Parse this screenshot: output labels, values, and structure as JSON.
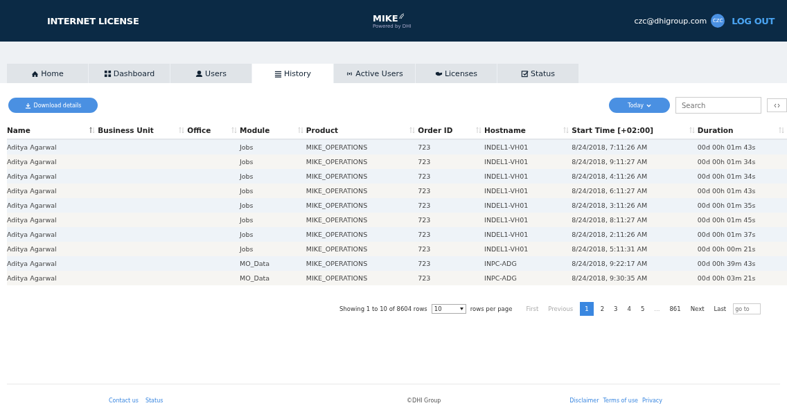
{
  "header": {
    "title": "INTERNET LICENSE",
    "logo": {
      "name": "MIKE",
      "tagline": "Powered by DHI"
    },
    "user_email": "czc@dhigroup.com",
    "avatar": "CZC",
    "logout": "LOG OUT"
  },
  "tabs": [
    {
      "label": "Home",
      "selected": false
    },
    {
      "label": "Dashboard",
      "selected": false
    },
    {
      "label": "Users",
      "selected": false
    },
    {
      "label": "History",
      "selected": true
    },
    {
      "label": "Active Users",
      "selected": false
    },
    {
      "label": "Licenses",
      "selected": false
    },
    {
      "label": "Status",
      "selected": false
    }
  ],
  "toolbar": {
    "download": "Download details",
    "period": "Today",
    "search": {
      "placeholder": "Search"
    }
  },
  "table": {
    "columns": [
      {
        "label": "Name",
        "sorted": true
      },
      {
        "label": "Business Unit",
        "sorted": false
      },
      {
        "label": "Office",
        "sorted": false
      },
      {
        "label": "Module",
        "sorted": false
      },
      {
        "label": "Product",
        "sorted": false
      },
      {
        "label": "Order ID",
        "sorted": false
      },
      {
        "label": "Hostname",
        "sorted": false
      },
      {
        "label": "Start Time [+02:00]",
        "sorted": false
      },
      {
        "label": "Duration",
        "sorted": false
      }
    ],
    "rows": [
      [
        "Aditya Agarwal",
        "",
        "",
        "Jobs",
        "MIKE_OPERATIONS",
        "723",
        "INDEL1-VH01",
        "8/24/2018, 7:11:26 AM",
        "00d 00h 01m 43s"
      ],
      [
        "Aditya Agarwal",
        "",
        "",
        "Jobs",
        "MIKE_OPERATIONS",
        "723",
        "INDEL1-VH01",
        "8/24/2018, 9:11:27 AM",
        "00d 00h 01m 34s"
      ],
      [
        "Aditya Agarwal",
        "",
        "",
        "Jobs",
        "MIKE_OPERATIONS",
        "723",
        "INDEL1-VH01",
        "8/24/2018, 4:11:26 AM",
        "00d 00h 01m 34s"
      ],
      [
        "Aditya Agarwal",
        "",
        "",
        "Jobs",
        "MIKE_OPERATIONS",
        "723",
        "INDEL1-VH01",
        "8/24/2018, 6:11:27 AM",
        "00d 00h 01m 43s"
      ],
      [
        "Aditya Agarwal",
        "",
        "",
        "Jobs",
        "MIKE_OPERATIONS",
        "723",
        "INDEL1-VH01",
        "8/24/2018, 3:11:26 AM",
        "00d 00h 01m 35s"
      ],
      [
        "Aditya Agarwal",
        "",
        "",
        "Jobs",
        "MIKE_OPERATIONS",
        "723",
        "INDEL1-VH01",
        "8/24/2018, 8:11:27 AM",
        "00d 00h 01m 45s"
      ],
      [
        "Aditya Agarwal",
        "",
        "",
        "Jobs",
        "MIKE_OPERATIONS",
        "723",
        "INDEL1-VH01",
        "8/24/2018, 2:11:26 AM",
        "00d 00h 01m 37s"
      ],
      [
        "Aditya Agarwal",
        "",
        "",
        "Jobs",
        "MIKE_OPERATIONS",
        "723",
        "INDEL1-VH01",
        "8/24/2018, 5:11:31 AM",
        "00d 00h 00m 21s"
      ],
      [
        "Aditya Agarwal",
        "",
        "",
        "MO_Data",
        "MIKE_OPERATIONS",
        "723",
        "INPC-ADG",
        "8/24/2018, 9:22:17 AM",
        "00d 00h 39m 43s"
      ],
      [
        "Aditya Agarwal",
        "",
        "",
        "MO_Data",
        "MIKE_OPERATIONS",
        "723",
        "INPC-ADG",
        "8/24/2018, 9:30:35 AM",
        "00d 00h 03m 21s"
      ]
    ]
  },
  "pagination": {
    "summary": "Showing 1 to 10 of 8604 rows",
    "page_size": "10",
    "page_size_label": "rows per page",
    "items": [
      {
        "label": "First",
        "selected": false,
        "disabled": true
      },
      {
        "label": "Previous",
        "selected": false,
        "disabled": true
      },
      {
        "label": "1",
        "selected": true,
        "disabled": false
      },
      {
        "label": "2",
        "selected": false,
        "disabled": false
      },
      {
        "label": "3",
        "selected": false,
        "disabled": false
      },
      {
        "label": "4",
        "selected": false,
        "disabled": false
      },
      {
        "label": "5",
        "selected": false,
        "disabled": false
      },
      {
        "label": "...",
        "selected": false,
        "disabled": true
      },
      {
        "label": "861",
        "selected": false,
        "disabled": false
      },
      {
        "label": "Next",
        "selected": false,
        "disabled": false
      },
      {
        "label": "Last",
        "selected": false,
        "disabled": false
      }
    ],
    "goto": {
      "placeholder": "go to"
    }
  },
  "footer": {
    "left_links": [
      "Contact us",
      "Status"
    ],
    "copyright": "©DHI Group",
    "right_links": [
      "Disclaimer",
      "Terms of use",
      "Privacy"
    ]
  }
}
